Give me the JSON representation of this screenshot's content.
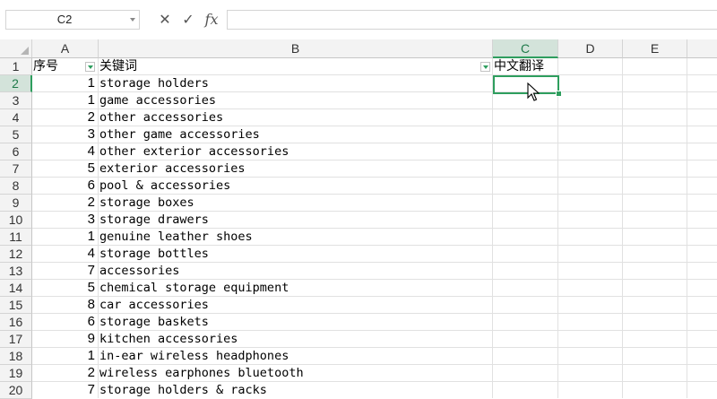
{
  "formula_bar": {
    "name_box": "C2",
    "cancel_glyph": "✕",
    "confirm_glyph": "✓",
    "fx_label": "fx",
    "formula_value": ""
  },
  "columns": [
    "A",
    "B",
    "C",
    "D",
    "E"
  ],
  "selected_cell": "C2",
  "header_row": {
    "row_number": "1",
    "a": "序号",
    "b": "关键词",
    "c": "中文翻译"
  },
  "rows": [
    {
      "n": "2",
      "a": "1",
      "b": "storage holders"
    },
    {
      "n": "3",
      "a": "1",
      "b": "game accessories"
    },
    {
      "n": "4",
      "a": "2",
      "b": "other accessories"
    },
    {
      "n": "5",
      "a": "3",
      "b": "other game accessories"
    },
    {
      "n": "6",
      "a": "4",
      "b": "other exterior accessories"
    },
    {
      "n": "7",
      "a": "5",
      "b": "exterior accessories"
    },
    {
      "n": "8",
      "a": "6",
      "b": "pool & accessories"
    },
    {
      "n": "9",
      "a": "2",
      "b": "storage boxes"
    },
    {
      "n": "10",
      "a": "3",
      "b": "storage drawers"
    },
    {
      "n": "11",
      "a": "1",
      "b": "genuine leather shoes"
    },
    {
      "n": "12",
      "a": "4",
      "b": "storage bottles"
    },
    {
      "n": "13",
      "a": "7",
      "b": "accessories"
    },
    {
      "n": "14",
      "a": "5",
      "b": "chemical storage equipment"
    },
    {
      "n": "15",
      "a": "8",
      "b": "car accessories"
    },
    {
      "n": "16",
      "a": "6",
      "b": "storage baskets"
    },
    {
      "n": "17",
      "a": "9",
      "b": "kitchen accessories"
    },
    {
      "n": "18",
      "a": "1",
      "b": "in-ear wireless headphones"
    },
    {
      "n": "19",
      "a": "2",
      "b": "wireless earphones bluetooth"
    },
    {
      "n": "20",
      "a": "7",
      "b": "storage holders & racks"
    }
  ],
  "colors": {
    "accent": "#2e9e5e",
    "header_bg": "#f3f3f3",
    "selected_header_bg": "#d3e3da",
    "gridline": "#e1e1e1"
  }
}
